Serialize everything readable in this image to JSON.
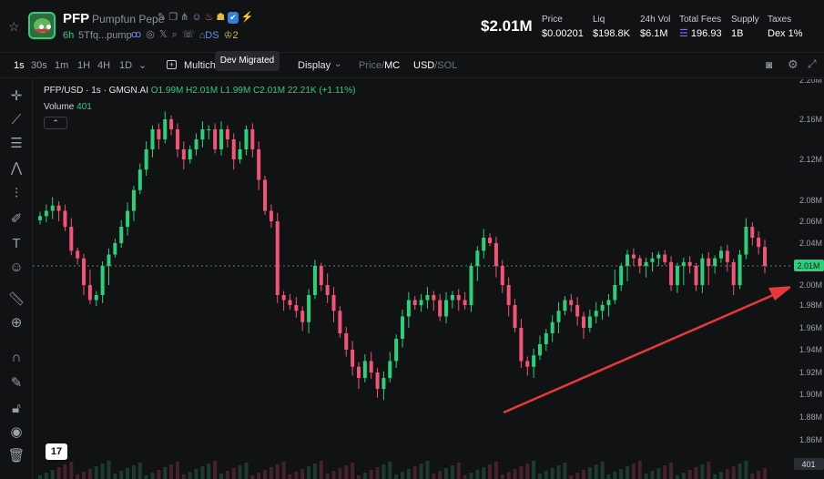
{
  "header": {
    "ticker": "PFP",
    "token_name": "Pumpfun Pepe",
    "age": "6h",
    "address": "5Tfq...pump",
    "dex_badge": "DS",
    "crown_count": "2",
    "market_cap": "$2.01M",
    "stats": [
      {
        "label": "Price",
        "value": "$0.00201"
      },
      {
        "label": "Liq",
        "value": "$198.8K"
      },
      {
        "label": "24h Vol",
        "value": "$6.1M"
      },
      {
        "label": "Total Fees",
        "value": "196.93"
      },
      {
        "label": "Supply",
        "value": "1B"
      },
      {
        "label": "Taxes",
        "value": "Dex 1%"
      }
    ],
    "icons": [
      "star-icon",
      "edit-icon",
      "copy-icon",
      "share-icon",
      "users-icon",
      "fire-icon",
      "group-icon",
      "tool-icon",
      "bolt-icon",
      "pump-icon",
      "globe-icon",
      "twitter-icon",
      "search-icon",
      "chat-icon",
      "dex-icon",
      "crown-icon"
    ]
  },
  "toolbar": {
    "timeframes": [
      "1s",
      "30s",
      "1m",
      "1H",
      "4H",
      "1D"
    ],
    "active_timeframe": "1s",
    "multi_label": "Multich",
    "display_label": "Display",
    "price_label": "Price",
    "mc_label": "MC",
    "usd_label": "USD",
    "sol_label": "SOL",
    "tooltip": "Dev Migrated"
  },
  "legend": {
    "pair": "PFP/USD · 1s · GMGN.AI",
    "ohlc": "O1.99M H2.01M L1.99M C2.01M 22.21K (+1.11%)",
    "volume_label": "Volume",
    "volume_value": "401"
  },
  "chart_data": {
    "type": "candlestick",
    "y_ticks": [
      "2.20M",
      "2.16M",
      "2.12M",
      "2.08M",
      "2.06M",
      "2.04M",
      "2.01M",
      "2.00M",
      "1.98M",
      "1.96M",
      "1.94M",
      "1.92M",
      "1.90M",
      "1.88M",
      "1.86M"
    ],
    "y_values": [
      2.2,
      2.16,
      2.12,
      2.08,
      2.06,
      2.04,
      2.01,
      2.0,
      1.98,
      1.96,
      1.94,
      1.92,
      1.9,
      1.88,
      1.86
    ],
    "current_price": "2.01M",
    "current_volume": "401",
    "up_color": "#2bd07a",
    "down_color": "#f25476",
    "arrow_color": "#e8383d",
    "closes": [
      2.065,
      2.07,
      2.075,
      2.07,
      2.055,
      2.03,
      2.02,
      2.0,
      1.985,
      1.99,
      2.01,
      2.025,
      2.04,
      2.055,
      2.07,
      2.09,
      2.11,
      2.13,
      2.15,
      2.14,
      2.16,
      2.15,
      2.13,
      2.12,
      2.13,
      2.14,
      2.15,
      2.15,
      2.13,
      2.15,
      2.14,
      2.12,
      2.13,
      2.15,
      2.13,
      2.1,
      2.07,
      2.06,
      1.99,
      1.985,
      1.98,
      1.975,
      1.965,
      1.99,
      2.01,
      2.0,
      1.99,
      1.975,
      1.955,
      1.94,
      1.925,
      1.915,
      1.93,
      1.92,
      1.905,
      1.915,
      1.93,
      1.95,
      1.97,
      1.985,
      1.98,
      1.985,
      1.99,
      1.985,
      1.97,
      1.985,
      1.99,
      1.985,
      1.98,
      2.01,
      2.03,
      2.045,
      2.04,
      2.01,
      2.0,
      1.98,
      1.96,
      1.93,
      1.925,
      1.935,
      1.945,
      1.955,
      1.965,
      1.975,
      1.985,
      1.98,
      1.97,
      1.96,
      1.97,
      1.975,
      1.98,
      1.985,
      2.0,
      2.01,
      2.025,
      2.02,
      2.01,
      2.015,
      2.02,
      2.025,
      2.015,
      2.0,
      2.01,
      2.015,
      2.01,
      2.0,
      2.02,
      2.01,
      2.02,
      2.03,
      2.015,
      2.0,
      2.025,
      2.055,
      2.045,
      2.035,
      2.01
    ],
    "dashed_price_line": 2.01
  }
}
